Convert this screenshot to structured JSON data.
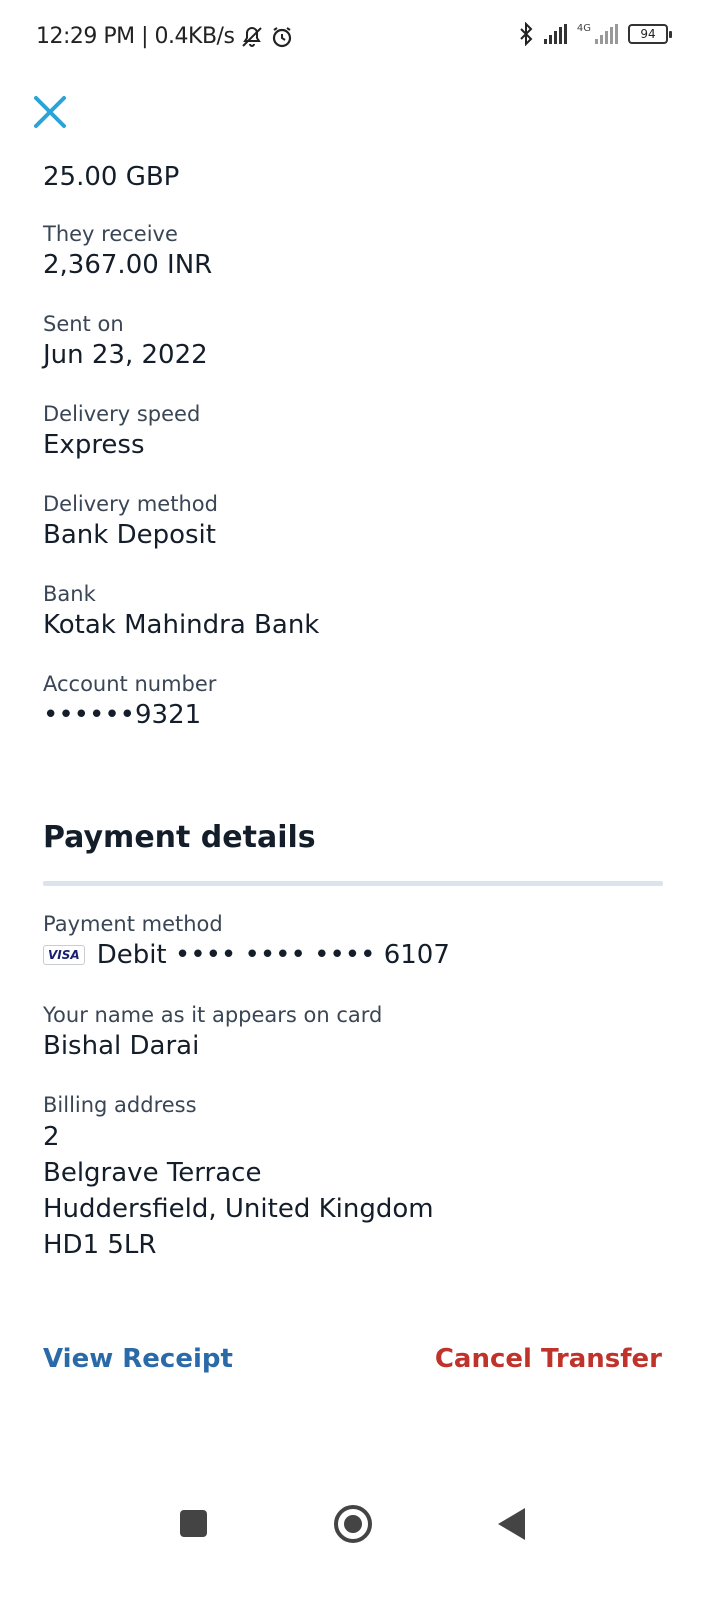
{
  "status_bar": {
    "time_speed": "12:29 PM | 0.4KB/s",
    "network_label": "4G",
    "battery": "94"
  },
  "transfer": {
    "sent_amount": "25.00 GBP",
    "they_receive_label": "They receive",
    "they_receive_value": "2,367.00 INR",
    "sent_on_label": "Sent on",
    "sent_on_value": "Jun 23, 2022",
    "delivery_speed_label": "Delivery speed",
    "delivery_speed_value": "Express",
    "delivery_method_label": "Delivery method",
    "delivery_method_value": "Bank Deposit",
    "bank_label": "Bank",
    "bank_value": "Kotak Mahindra Bank",
    "account_number_label": "Account number",
    "account_number_value": "••••••9321"
  },
  "payment": {
    "section_title": "Payment details",
    "payment_method_label": "Payment method",
    "card_brand": "VISA",
    "card_value": "Debit •••• •••• •••• 6107",
    "name_label": "Your name as it appears on card",
    "name_value": "Bishal Darai",
    "billing_label": "Billing address",
    "billing_lines": [
      "2",
      "Belgrave Terrace",
      "Huddersfield, United Kingdom",
      "HD1 5LR"
    ]
  },
  "actions": {
    "view_receipt": "View Receipt",
    "cancel_transfer": "Cancel Transfer"
  },
  "icons": {
    "close": "close-icon",
    "mute": "mute-icon",
    "alarm": "alarm-icon",
    "bluetooth": "bluetooth-icon"
  },
  "colors": {
    "close_icon": "#2aa3d8",
    "link_blue": "#2a6aa8",
    "cancel_red": "#c0332b",
    "divider": "#dde3ea"
  }
}
